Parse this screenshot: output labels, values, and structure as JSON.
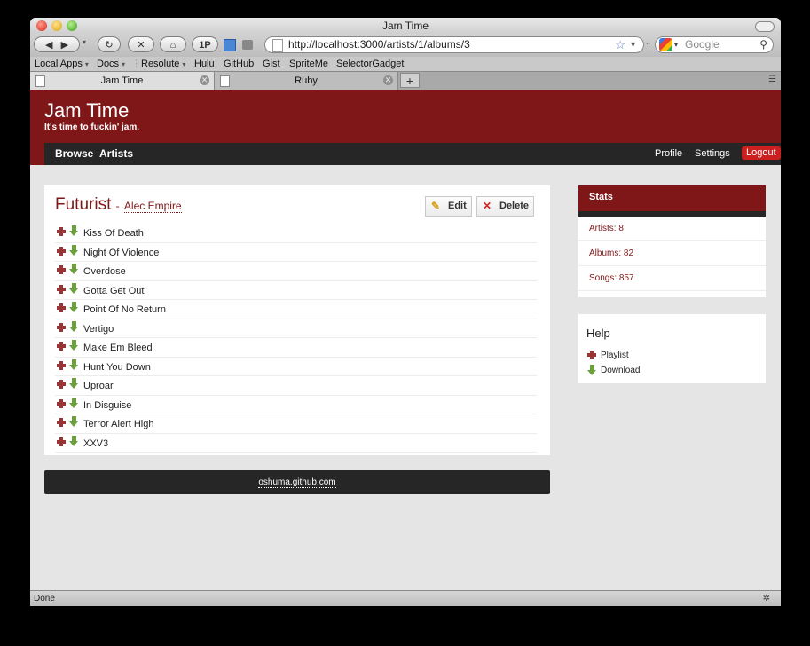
{
  "window": {
    "title": "Jam Time"
  },
  "toolbar": {
    "url": "http://localhost:3000/artists/1/albums/3",
    "search_placeholder": "Google",
    "onepassword": "1P"
  },
  "bookmarks": [
    "Local Apps",
    "Docs",
    "Resolute",
    "Hulu",
    "GitHub",
    "Gist",
    "SpriteMe",
    "SelectorGadget"
  ],
  "tabs": [
    {
      "label": "Jam Time"
    },
    {
      "label": "Ruby"
    }
  ],
  "site": {
    "brand": "Jam Time",
    "tagline": "It's time to fuckin' jam.",
    "nav": [
      "Browse",
      "Artists"
    ],
    "nav_right": [
      "Profile",
      "Settings"
    ],
    "logout": "Logout"
  },
  "album": {
    "title": "Futurist",
    "separator": "-",
    "artist": "Alec Empire",
    "edit_label": "Edit",
    "delete_label": "Delete",
    "tracks": [
      "Kiss Of Death",
      "Night Of Violence",
      "Overdose",
      "Gotta Get Out",
      "Point Of No Return",
      "Vertigo",
      "Make Em Bleed",
      "Hunt You Down",
      "Uproar",
      "In Disguise",
      "Terror Alert High",
      "XXV3"
    ]
  },
  "footer": {
    "link": "oshuma.github.com"
  },
  "stats": {
    "title": "Stats",
    "items": [
      "Artists: 8",
      "Albums: 82",
      "Songs: 857"
    ]
  },
  "help": {
    "title": "Help",
    "items": [
      {
        "label": "Playlist",
        "icon": "plus-icon"
      },
      {
        "label": "Download",
        "icon": "download-arrow-icon"
      }
    ]
  },
  "statusbar": {
    "text": "Done"
  },
  "colors": {
    "brand": "#7f1719",
    "navbar": "#262626",
    "logout": "#cc1f1f",
    "accent_green": "#6ca03c"
  }
}
